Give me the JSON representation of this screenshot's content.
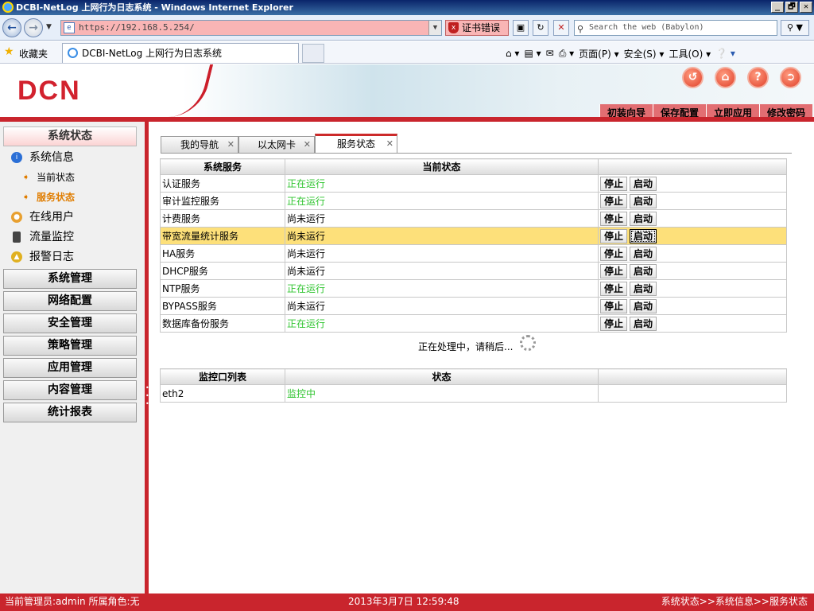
{
  "browser": {
    "window_title": "DCBI-NetLog 上网行为日志系统 - Windows Internet Explorer",
    "window_buttons": [
      "_",
      "🗗",
      "✕"
    ],
    "address": "https://192.168.5.254/",
    "cert_error": "证书错误",
    "search_placeholder": "Search the web (Babylon)",
    "favorites_label": "收藏夹",
    "tab_title": "DCBI-NetLog 上网行为日志系统",
    "cmd": {
      "page": "页面(P)",
      "safety": "安全(S)",
      "tools": "工具(O)"
    }
  },
  "header": {
    "logo": "DCN",
    "top_links": [
      "初装向导",
      "保存配置",
      "立即应用",
      "修改密码"
    ]
  },
  "sidebar": {
    "active_section": "系统状态",
    "groups": [
      {
        "label": "系统信息",
        "icon": "info-icon"
      },
      {
        "label": "在线用户",
        "icon": "user-icon"
      },
      {
        "label": "流量监控",
        "icon": "traffic-light-icon"
      },
      {
        "label": "报警日志",
        "icon": "bell-icon"
      }
    ],
    "children": [
      {
        "label": "当前状态"
      },
      {
        "label": "服务状态"
      }
    ],
    "sections": [
      "系统管理",
      "网络配置",
      "安全管理",
      "策略管理",
      "应用管理",
      "内容管理",
      "统计报表"
    ]
  },
  "tabs": [
    "我的导航",
    "以太网卡",
    "服务状态"
  ],
  "services": {
    "headers": [
      "系统服务",
      "当前状态",
      ""
    ],
    "stop_label": "停止",
    "start_label": "启动",
    "rows": [
      {
        "name": "认证服务",
        "status": "正在运行",
        "running": true
      },
      {
        "name": "审计监控服务",
        "status": "正在运行",
        "running": true
      },
      {
        "name": "计费服务",
        "status": "尚未运行",
        "running": false
      },
      {
        "name": "带宽流量统计服务",
        "status": "尚未运行",
        "running": false
      },
      {
        "name": "HA服务",
        "status": "尚未运行",
        "running": false
      },
      {
        "name": "DHCP服务",
        "status": "尚未运行",
        "running": false
      },
      {
        "name": "NTP服务",
        "status": "正在运行",
        "running": true
      },
      {
        "name": "BYPASS服务",
        "status": "尚未运行",
        "running": false
      },
      {
        "name": "数据库备份服务",
        "status": "正在运行",
        "running": true
      }
    ]
  },
  "processing_text": "正在处理中，请稍后...",
  "monitor": {
    "headers": [
      "监控口列表",
      "状态",
      ""
    ],
    "rows": [
      {
        "port": "eth2",
        "status": "监控中"
      }
    ]
  },
  "statusbar": {
    "left": "当前管理员:admin  所属角色:无",
    "center": "2013年3月7日 12:59:48",
    "right": "系统状态>>系统信息>>服务状态"
  },
  "colors": {
    "accent_red": "#c9252d",
    "running_green": "#2fc42f",
    "highlight_row": "#fde07a",
    "active_child": "#e07d00"
  }
}
